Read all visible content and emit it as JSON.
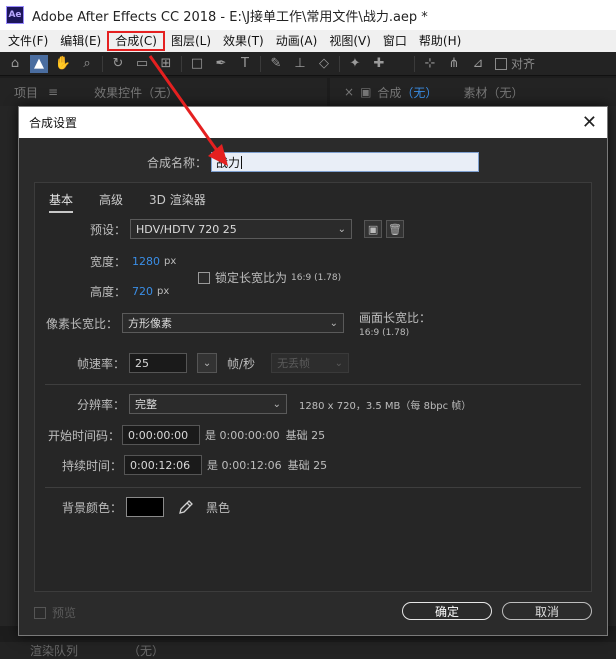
{
  "app": {
    "title": "Adobe After Effects CC 2018 - E:\\J接单工作\\常用文件\\战力.aep *",
    "icon_label": "Ae"
  },
  "menu": [
    "文件(F)",
    "编辑(E)",
    "合成(C)",
    "图层(L)",
    "效果(T)",
    "动画(A)",
    "视图(V)",
    "窗口",
    "帮助(H)"
  ],
  "toolbar": {
    "snap_label": "对齐"
  },
  "panels": {
    "left_tab1": "项目",
    "left_tab2": "效果控件（无）",
    "right_tab1_prefix": "合成",
    "right_tab1_value": "（无）",
    "right_tab2": "素材（无）",
    "bottom_tab": "渲染队列",
    "bottom_value": "（无）"
  },
  "dialog": {
    "title": "合成设置",
    "name_label": "合成名称：",
    "name_value": "战力",
    "tabs": [
      "基本",
      "高级",
      "3D 渲染器"
    ],
    "preset_label": "预设：",
    "preset_value": "HDV/HDTV 720 25",
    "width_label": "宽度：",
    "width_value": "1280",
    "height_label": "高度：",
    "height_value": "720",
    "px_unit": "px",
    "lock_label": "锁定长宽比为",
    "lock_ratio": "16:9 (1.78)",
    "pixel_aspect_label": "像素长宽比：",
    "pixel_aspect_value": "方形像素",
    "frame_aspect_label": "画面长宽比：",
    "frame_aspect_value": "16:9 (1.78)",
    "fps_label": "帧速率：",
    "fps_value": "25",
    "fps_unit": "帧/秒",
    "drop_frame": "无丢帧",
    "resolution_label": "分辨率：",
    "resolution_value": "完整",
    "resolution_info": "1280 x 720，3.5 MB（每 8bpc 帧）",
    "start_tc_label": "开始时间码：",
    "start_tc_value": "0:00:00:00",
    "start_tc_is": "是 0:00:00:00",
    "start_tc_base": "基础 25",
    "duration_label": "持续时间：",
    "duration_value": "0:00:12:06",
    "duration_is": "是 0:00:12:06",
    "duration_base": "基础 25",
    "bg_color_label": "背景颜色：",
    "bg_color_name": "黑色",
    "preview_label": "预览",
    "ok": "确定",
    "cancel": "取消"
  },
  "colors": {
    "accent_blue": "#3a8ee6",
    "annotation_red": "#e52020",
    "background_color": "#000000"
  }
}
